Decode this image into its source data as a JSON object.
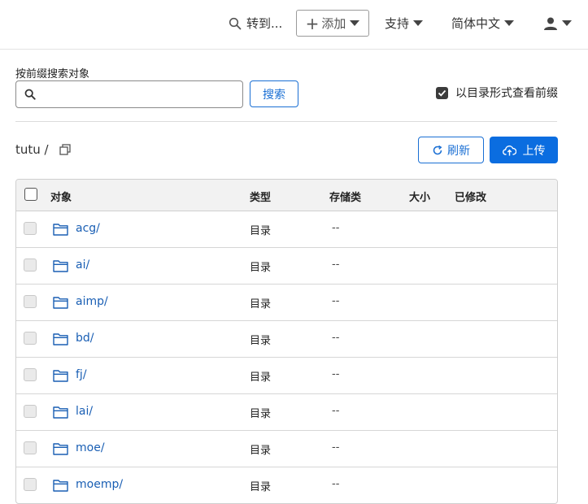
{
  "topbar": {
    "goto_label": "转到...",
    "add_label": "添加",
    "support_label": "支持",
    "language_label": "简体中文"
  },
  "search": {
    "label": "按前缀搜索对象",
    "value": "",
    "placeholder": "",
    "button_label": "搜索",
    "dir_view_label": "以目录形式查看前缀",
    "dir_view_checked": true
  },
  "breadcrumb": {
    "path": "tutu /"
  },
  "actions": {
    "refresh_label": "刷新",
    "upload_label": "上传"
  },
  "table": {
    "headers": {
      "object": "对象",
      "type": "类型",
      "storage": "存储类",
      "size": "大小",
      "modified": "已修改"
    },
    "rows": [
      {
        "name": "acg/",
        "type": "目录",
        "storage": "--"
      },
      {
        "name": "ai/",
        "type": "目录",
        "storage": "--"
      },
      {
        "name": "aimp/",
        "type": "目录",
        "storage": "--"
      },
      {
        "name": "bd/",
        "type": "目录",
        "storage": "--"
      },
      {
        "name": "fj/",
        "type": "目录",
        "storage": "--"
      },
      {
        "name": "lai/",
        "type": "目录",
        "storage": "--"
      },
      {
        "name": "moe/",
        "type": "目录",
        "storage": "--"
      },
      {
        "name": "moemp/",
        "type": "目录",
        "storage": "--"
      }
    ]
  },
  "colors": {
    "accent": "#0b6de0",
    "link": "#1a5fb4",
    "border": "#cfcfcf"
  }
}
